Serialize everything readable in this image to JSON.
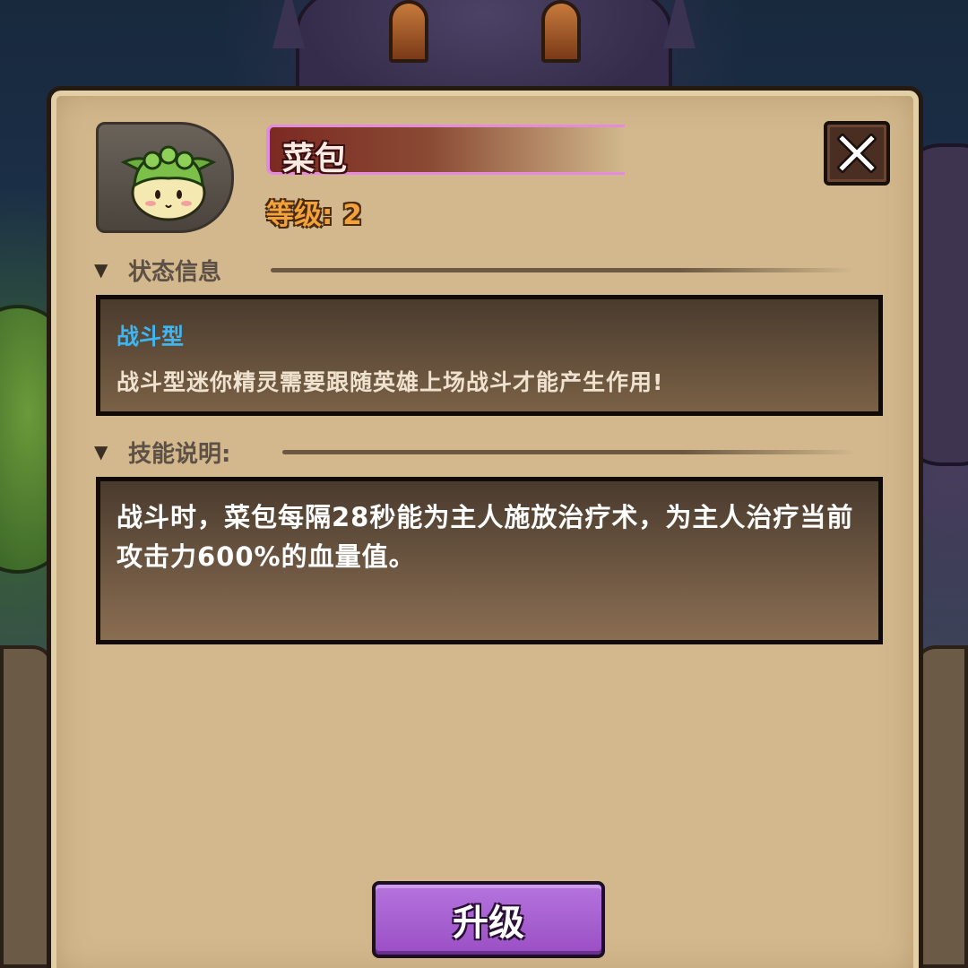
{
  "sprite": {
    "name": "菜包",
    "level_text": "等级: 2",
    "portrait_icon": "leaf-sprite-icon"
  },
  "close_icon": "close-icon",
  "status_section": {
    "title": "状态信息",
    "type": "战斗型",
    "description": "战斗型迷你精灵需要跟随英雄上场战斗才能产生作用!"
  },
  "skill_section": {
    "title": "技能说明:",
    "description": "战斗时，菜包每隔28秒能为主人施放治疗术，为主人治疗当前攻击力600%的血量值。"
  },
  "buttons": {
    "upgrade": "升级"
  },
  "colors": {
    "panel": "#d2b88c",
    "name_accent": "#e48adf",
    "type_text": "#3fb6f2",
    "level_text": "#f2a23a",
    "upgrade_button": "#a85cd1"
  }
}
